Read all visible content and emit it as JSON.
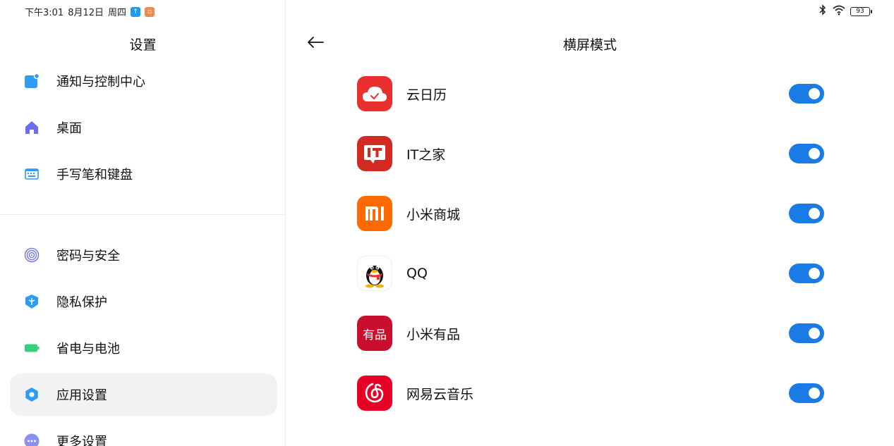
{
  "status_bar": {
    "time": "下午3:01",
    "date": "8月12日",
    "weekday": "周四",
    "battery": "93"
  },
  "settings_list": {
    "title": "设置",
    "items": [
      {
        "label": "通知与控制中心",
        "icon": "notification-icon",
        "color": "#2f9bf4"
      },
      {
        "label": "桌面",
        "icon": "home-icon",
        "color": "#6d6cf0"
      },
      {
        "label": "手写笔和键盘",
        "icon": "keyboard-icon",
        "color": "#2f9bf4"
      },
      {
        "label": "密码与安全",
        "icon": "fingerprint-icon",
        "color": "#7a7ae8"
      },
      {
        "label": "隐私保护",
        "icon": "privacy-icon",
        "color": "#2f9bf4"
      },
      {
        "label": "省电与电池",
        "icon": "battery-icon",
        "color": "#35d07f"
      },
      {
        "label": "应用设置",
        "icon": "gear-icon",
        "color": "#2f9bf4"
      },
      {
        "label": "更多设置",
        "icon": "more-icon",
        "color": "#8a8ff0"
      }
    ],
    "active_index": 6
  },
  "detail": {
    "title": "横屏模式",
    "apps": [
      {
        "name": "云日历",
        "icon": "cloud-calendar-icon",
        "enabled": true,
        "color": "#e8302f"
      },
      {
        "name": "IT之家",
        "icon": "ithome-icon",
        "enabled": true,
        "color": "#d42a24"
      },
      {
        "name": "小米商城",
        "icon": "mi-store-icon",
        "enabled": true,
        "color": "#ff6a00"
      },
      {
        "name": "QQ",
        "icon": "qq-icon",
        "enabled": true,
        "color": "#ffffff"
      },
      {
        "name": "小米有品",
        "icon": "youpin-icon",
        "enabled": true,
        "color": "#c8102e",
        "logo_text": "有品"
      },
      {
        "name": "网易云音乐",
        "icon": "netease-music-icon",
        "enabled": true,
        "color": "#e60026"
      }
    ]
  },
  "colors": {
    "accent": "#1a7be6",
    "active_bg": "#f2f2f2"
  }
}
